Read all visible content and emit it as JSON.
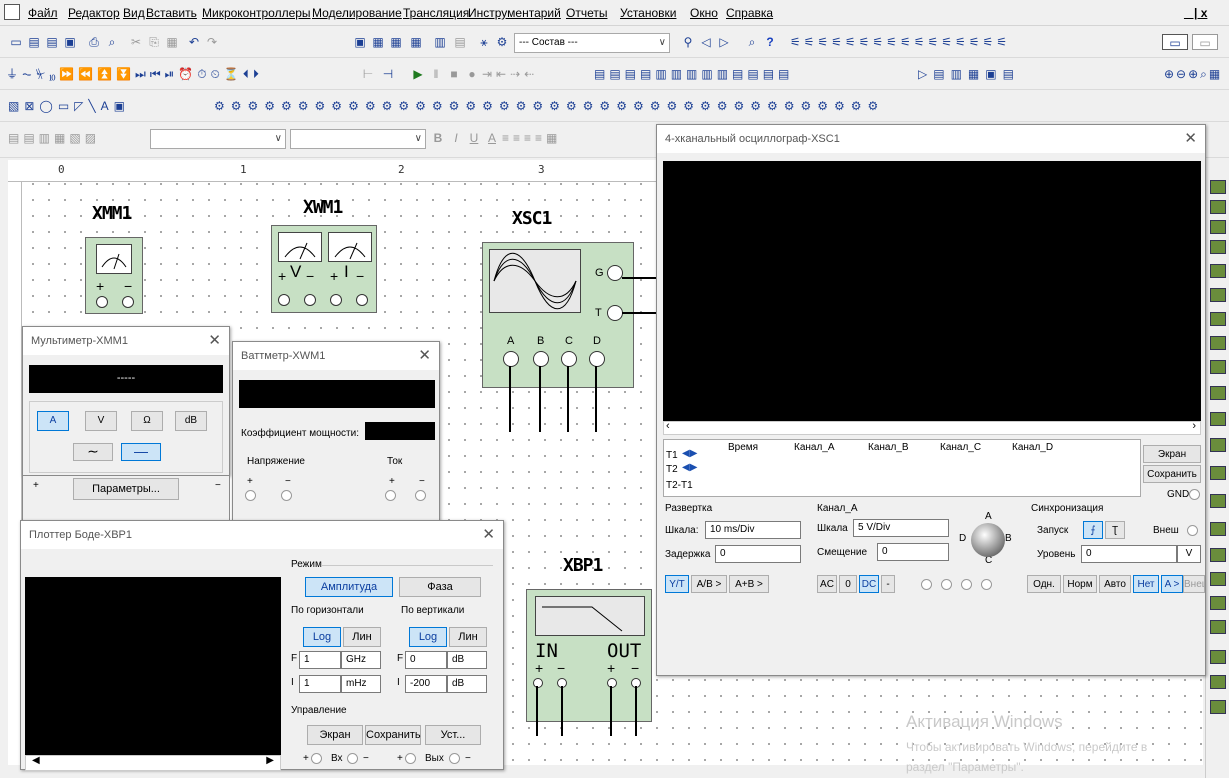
{
  "menu": [
    "Файл",
    "Редактор",
    "Вид",
    "Вставить",
    "Микроконтроллеры",
    "Моделирование",
    "Трансляция",
    "Инструментарий",
    "Отчеты",
    "Установки",
    "Окно",
    "Справка"
  ],
  "window_controls": "_ | x",
  "toolbar": {
    "component_combo": "--- Состав ---",
    "font_bold": "B",
    "font_italic": "I",
    "font_underline": "U",
    "font_color": "A"
  },
  "ruler": [
    "0",
    "1",
    "2",
    "3"
  ],
  "instruments": {
    "xmm1": {
      "name": "XMM1",
      "plus": "+",
      "minus": "−"
    },
    "xwm1": {
      "name": "XWM1",
      "v": "V",
      "i": "I",
      "plus": "+",
      "minus": "−"
    },
    "xsc1": {
      "name": "XSC1",
      "g": "G",
      "t": "T",
      "channels": [
        "A",
        "B",
        "C",
        "D"
      ]
    },
    "xbp1": {
      "name": "XBP1",
      "in": "IN",
      "out": "OUT",
      "plus": "+",
      "minus": "−"
    }
  },
  "multimeter": {
    "title": "Мультиметр-XMM1",
    "display": "-----",
    "buttons": [
      "A",
      "V",
      "Ω",
      "dB"
    ],
    "ac_symbol": "∼",
    "dc_symbol": "—",
    "params_button": "Параметры...",
    "plus": "+",
    "minus": "−"
  },
  "wattmeter": {
    "title": "Ваттметр-XWM1",
    "power_factor_label": "Коэффициент мощности:",
    "voltage_label": "Напряжение",
    "current_label": "Ток",
    "plus": "+",
    "minus": "−"
  },
  "bode": {
    "title": "Плоттер Боде-XBP1",
    "mode_label": "Режим",
    "amplitude_button": "Амплитуда",
    "phase_button": "Фаза",
    "horizontal_label": "По горизонтали",
    "vertical_label": "По вертикали",
    "log_button": "Log",
    "lin_button": "Лин",
    "h_f_value": "1",
    "h_f_unit": "GHz",
    "h_i_value": "1",
    "h_i_unit": "mHz",
    "v_f_value": "0",
    "v_f_unit": "dB",
    "v_i_value": "-200",
    "v_i_unit": "dB",
    "f_label": "F",
    "i_label": "I",
    "control_label": "Управление",
    "screen_button": "Экран",
    "save_button": "Сохранить",
    "set_button": "Уст...",
    "in_label": "Вх",
    "out_label": "Вых",
    "plus": "+",
    "minus": "−"
  },
  "oscilloscope": {
    "title": "4-хканальный осциллограф-XSC1",
    "t1_label": "T1",
    "t2_label": "T2",
    "t2t1_label": "T2-T1",
    "columns": [
      "Время",
      "Канал_A",
      "Канал_B",
      "Канал_C",
      "Канал_D"
    ],
    "screen_button": "Экран",
    "save_button": "Сохранить",
    "gnd_label": "GND",
    "timebase_label": "Развертка",
    "scale_label": "Шкала:",
    "scale_value": "10 ms/Div",
    "delay_label": "Задержка",
    "delay_value": "0",
    "mode_buttons": [
      "Y/T",
      "A/B >",
      "A+B >"
    ],
    "channel_label": "Канал_A",
    "ch_scale_label": "Шкала",
    "ch_scale_value": "5 V/Div",
    "offset_label": "Смещение",
    "offset_value": "0",
    "coupling_buttons": [
      "AC",
      "0",
      "DC",
      "-"
    ],
    "knob_labels": [
      "A",
      "B",
      "C",
      "D"
    ],
    "trigger_label": "Синхронизация",
    "start_label": "Запуск",
    "ext_label": "Внеш",
    "level_label": "Уровень",
    "level_value": "0",
    "level_unit": "V",
    "trigger_buttons": [
      "Одн.",
      "Норм",
      "Авто",
      "Нет",
      "A >",
      "Внеш"
    ]
  },
  "watermark": {
    "line1": "Активация Windows",
    "line2": "Чтобы активировать Windows, перейдите в",
    "line3": "раздел \"Параметры\"."
  }
}
